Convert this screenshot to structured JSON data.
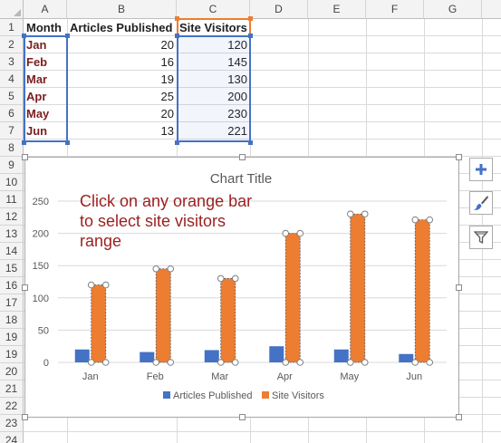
{
  "columns": [
    "A",
    "B",
    "C",
    "D",
    "E",
    "F",
    "G"
  ],
  "rows": [
    "1",
    "2",
    "3",
    "4",
    "5",
    "6",
    "7",
    "8",
    "9",
    "10",
    "11",
    "12",
    "13",
    "14",
    "15",
    "16",
    "17",
    "18",
    "19",
    "19",
    "20",
    "21",
    "22",
    "23",
    "24"
  ],
  "table": {
    "headers": [
      "Month",
      "Articles Published",
      "Site Visitors"
    ],
    "data": [
      [
        "Jan",
        "20",
        "120"
      ],
      [
        "Feb",
        "16",
        "145"
      ],
      [
        "Mar",
        "19",
        "130"
      ],
      [
        "Apr",
        "25",
        "200"
      ],
      [
        "May",
        "20",
        "230"
      ],
      [
        "Jun",
        "13",
        "221"
      ]
    ]
  },
  "annotation": "Click on any orange bar to select site visitors range",
  "side_buttons": [
    "plus-icon",
    "brush-icon",
    "filter-icon"
  ],
  "colors": {
    "articles": "#4472c4",
    "visitors": "#ed7d31",
    "annotation": "#9b1f1f",
    "range": "#4472c4"
  },
  "chart_data": {
    "type": "bar",
    "title": "Chart Title",
    "categories": [
      "Jan",
      "Feb",
      "Mar",
      "Apr",
      "May",
      "Jun"
    ],
    "series": [
      {
        "name": "Articles Published",
        "values": [
          20,
          16,
          19,
          25,
          20,
          13
        ],
        "color": "#4472c4"
      },
      {
        "name": "Site Visitors",
        "values": [
          120,
          145,
          130,
          200,
          230,
          221
        ],
        "color": "#ed7d31",
        "selected": true
      }
    ],
    "yticks": [
      "0",
      "50",
      "100",
      "150",
      "200",
      "250"
    ],
    "ylim": [
      0,
      250
    ],
    "grid": true,
    "legend": "bottom"
  }
}
